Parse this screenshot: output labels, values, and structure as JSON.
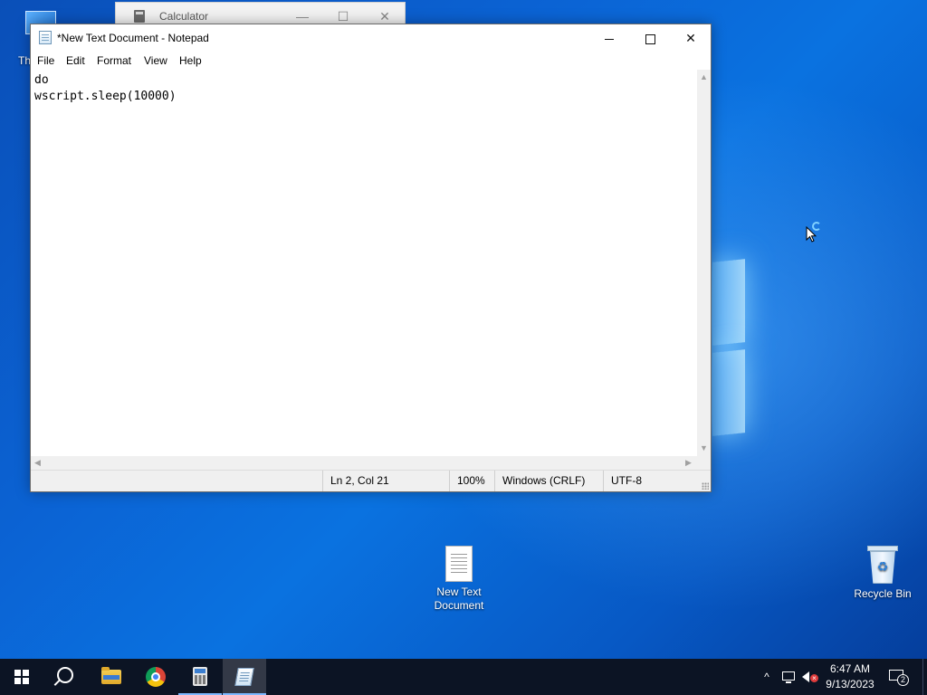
{
  "desktop": {
    "partial_icon_label": "Th",
    "icons": [
      {
        "label": "New Text Document"
      },
      {
        "label": "Recycle Bin"
      }
    ]
  },
  "calculator": {
    "title": "Calculator",
    "min_glyph": "—",
    "max_glyph": "☐",
    "close_glyph": "✕"
  },
  "notepad": {
    "title": "*New Text Document - Notepad",
    "close_glyph": "✕",
    "menu": {
      "file": "File",
      "edit": "Edit",
      "format": "Format",
      "view": "View",
      "help": "Help"
    },
    "content": "do\nwscript.sleep(10000)",
    "status": {
      "position": "Ln 2, Col 21",
      "zoom": "100%",
      "line_endings": "Windows (CRLF)",
      "encoding": "UTF-8"
    },
    "scroll_up": "▲",
    "scroll_down": "▼",
    "scroll_left": "◀",
    "scroll_right": "▶"
  },
  "taskbar": {
    "apps": [
      {
        "name": "Start",
        "icon": "windows-start-icon"
      },
      {
        "name": "Search",
        "icon": "search-icon"
      },
      {
        "name": "File Explorer",
        "icon": "folder-icon"
      },
      {
        "name": "Google Chrome",
        "icon": "chrome-icon"
      },
      {
        "name": "Calculator",
        "icon": "calculator-icon"
      },
      {
        "name": "Notepad",
        "icon": "notepad-icon"
      }
    ],
    "tray": {
      "chevron": "^",
      "volume_badge": "×",
      "time": "6:47 AM",
      "date": "9/13/2023",
      "notification_count": "2"
    }
  }
}
